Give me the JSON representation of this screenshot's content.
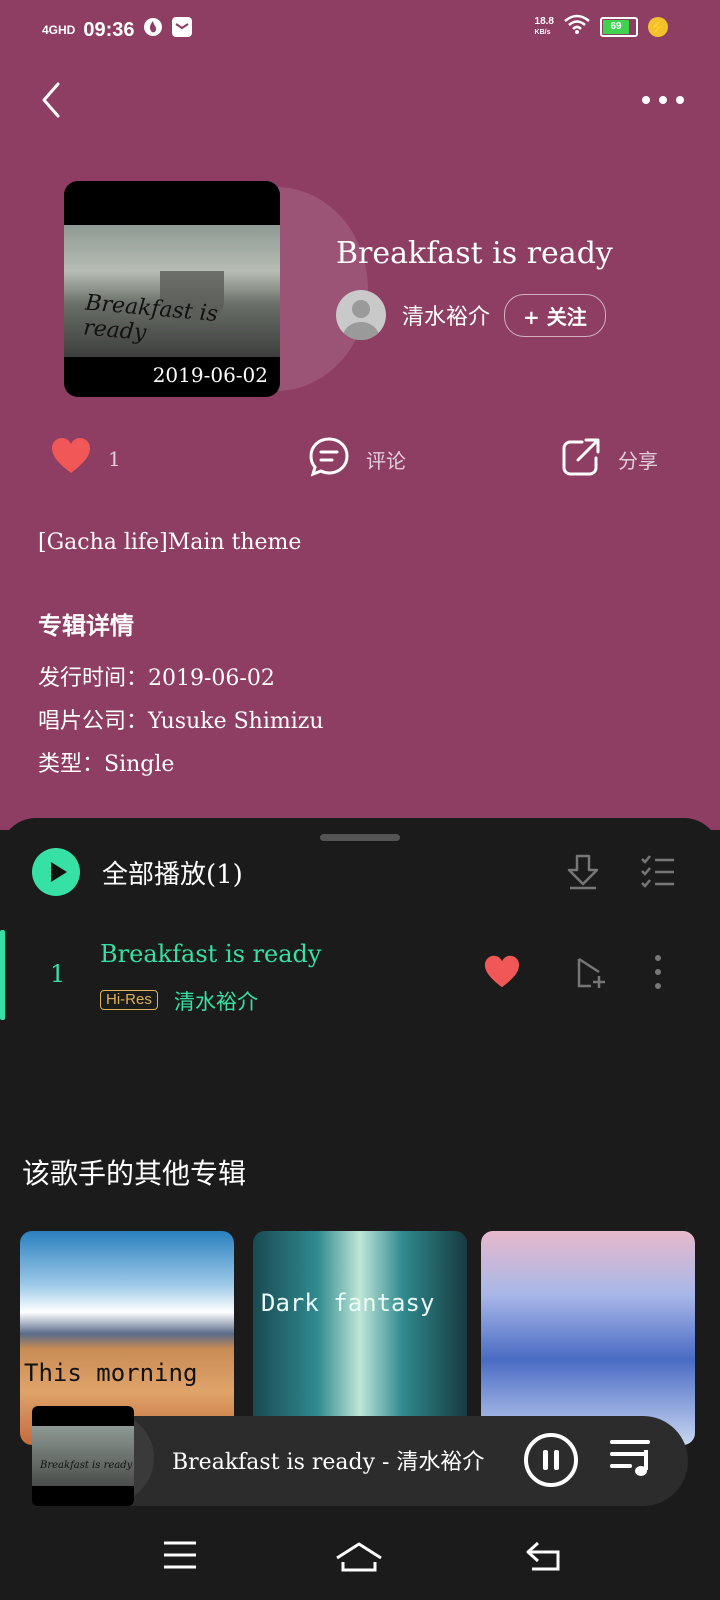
{
  "status": {
    "network": "4GHD",
    "time": "09:36",
    "speed_top": "18.8",
    "speed_bottom": "KB/s",
    "battery": "69"
  },
  "album": {
    "cover_script": "Breakfast is ready",
    "cover_date": "2019-06-02",
    "title": "Breakfast is ready"
  },
  "artist": {
    "name": "清水裕介",
    "follow_label": "+ 关注"
  },
  "actions": {
    "like_count": "1",
    "comment_label": "评论",
    "share_label": "分享"
  },
  "description": "[Gacha life]Main theme",
  "details": {
    "title": "专辑详情",
    "release": "发行时间：2019-06-02",
    "label": "唱片公司：Yusuke Shimizu",
    "type": "类型：Single"
  },
  "tracklist": {
    "play_all_label": "全部播放(1)",
    "tracks": [
      {
        "number": "1",
        "name": "Breakfast is ready",
        "badge": "Hi-Res",
        "artist": "清水裕介"
      }
    ]
  },
  "other_albums": {
    "title": "该歌手的其他专辑",
    "items": [
      {
        "label": "This morning"
      },
      {
        "label": "Dark fantasy"
      },
      {
        "label": ""
      }
    ]
  },
  "mini_player": {
    "cover_script": "Breakfast is ready",
    "now_playing": "Breakfast is ready - 清水裕介"
  },
  "colors": {
    "header_bg": "#8e3d63",
    "accent": "#37e0a4",
    "heart": "#f25757",
    "sheet_bg": "#1b1b1b"
  }
}
